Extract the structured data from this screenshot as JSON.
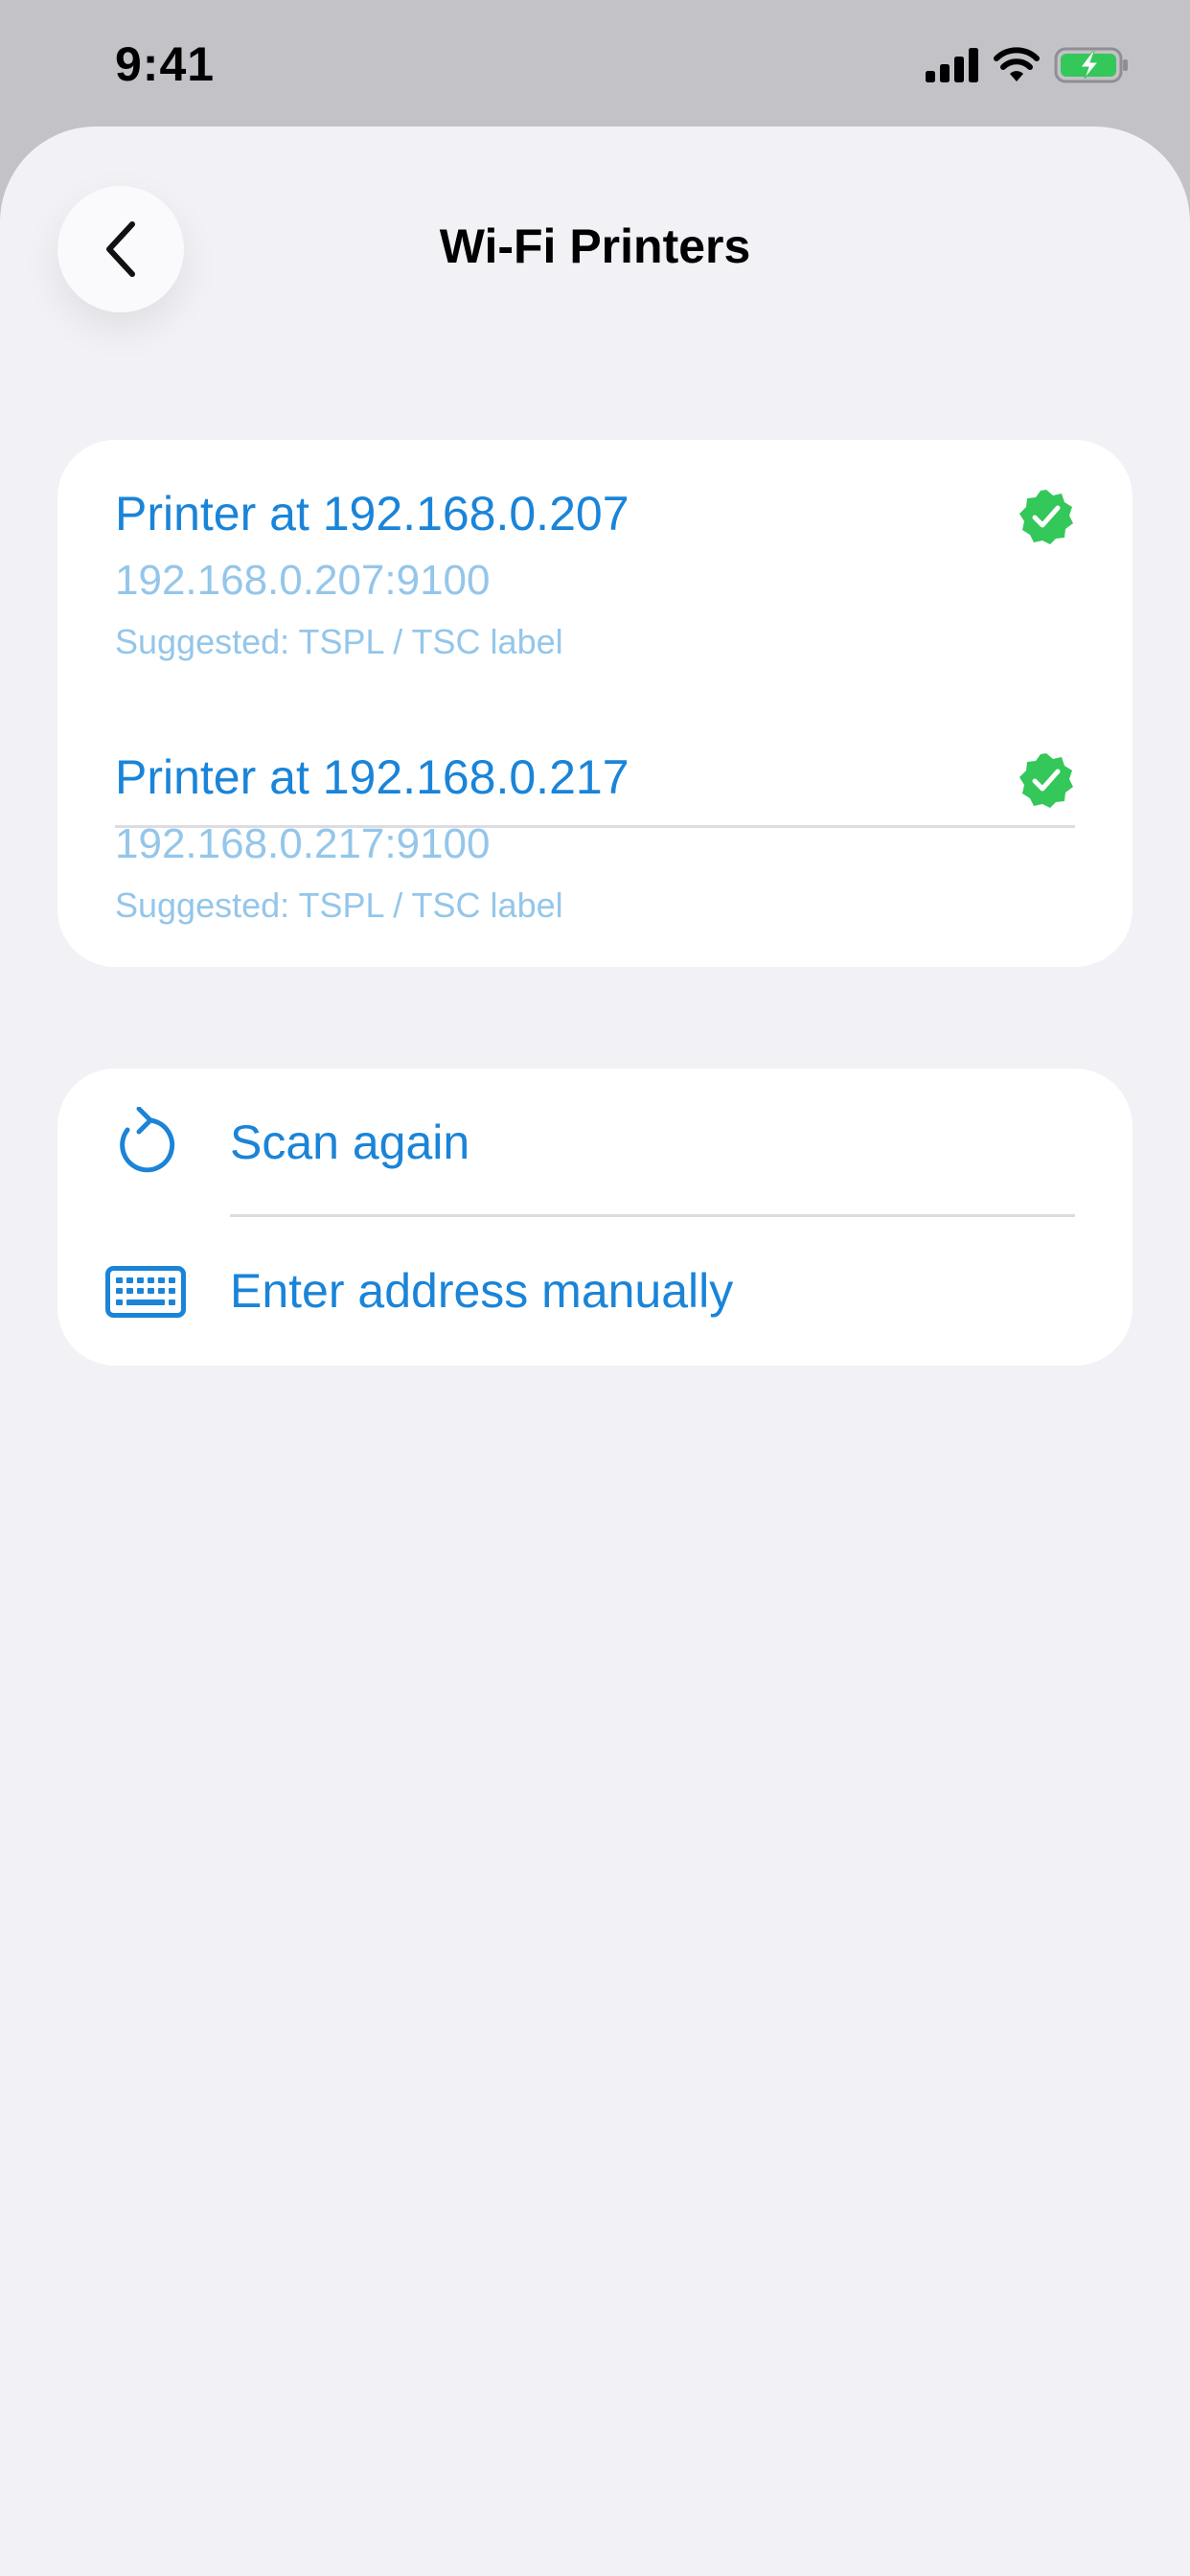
{
  "status_bar": {
    "time": "9:41",
    "icons": [
      "cellular-signal-icon",
      "wifi-icon",
      "battery-charging-icon"
    ]
  },
  "header": {
    "title": "Wi-Fi Printers",
    "back_icon": "chevron-left-icon"
  },
  "printers": [
    {
      "name": "Printer at 192.168.0.207",
      "address": "192.168.0.207:9100",
      "suggestion": "Suggested: TSPL / TSC label",
      "status_icon": "check-badge-icon"
    },
    {
      "name": "Printer at 192.168.0.217",
      "address": "192.168.0.217:9100",
      "suggestion": "Suggested: TSPL / TSC label",
      "status_icon": "check-badge-icon"
    }
  ],
  "actions": [
    {
      "label": "Scan again",
      "icon": "refresh-icon"
    },
    {
      "label": "Enter address manually",
      "icon": "keyboard-icon"
    }
  ],
  "colors": {
    "accent": "#1a84d8",
    "secondary_text": "#94c6ea",
    "success": "#34c759",
    "sheet_background": "#f1f1f6",
    "card_background": "#ffffff"
  }
}
